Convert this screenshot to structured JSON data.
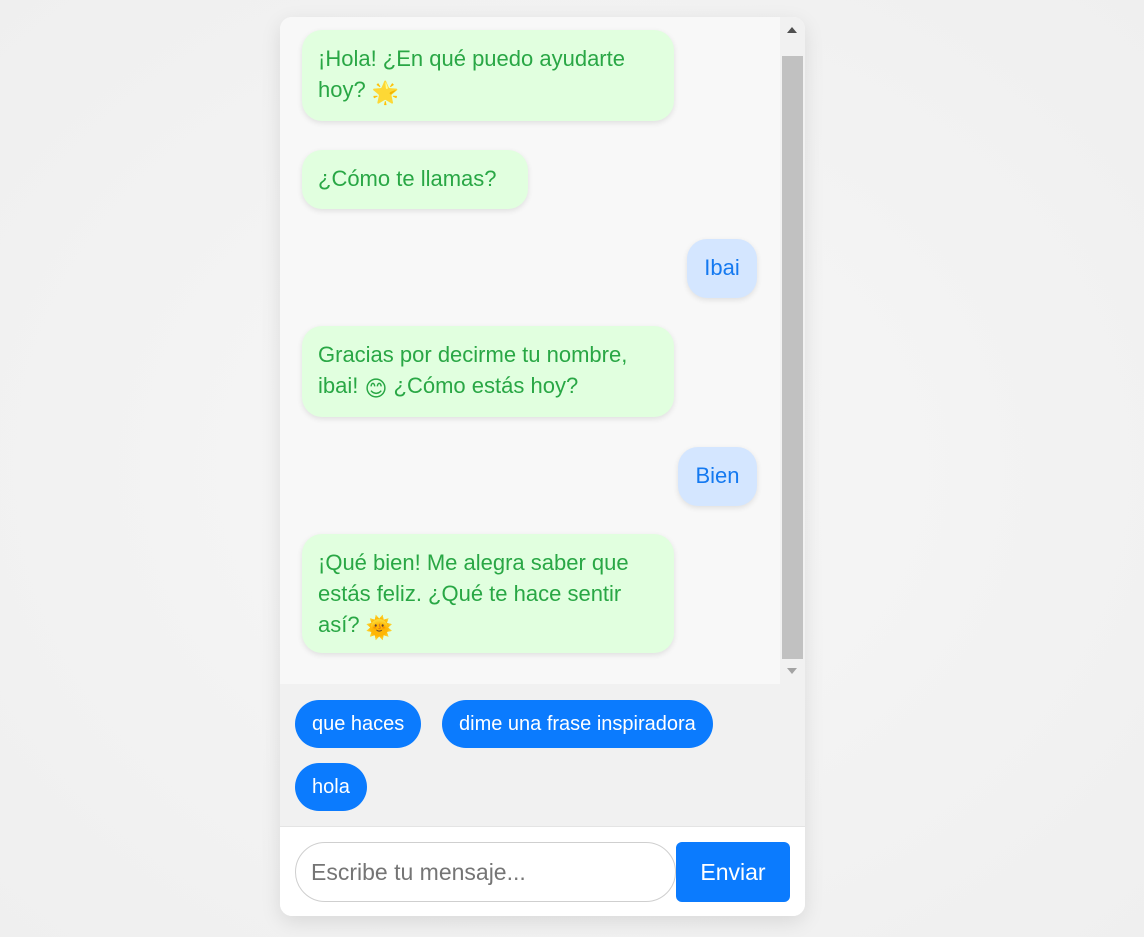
{
  "chat": {
    "messages": [
      {
        "sender": "bot",
        "text": "¡Hola! ¿En qué puedo ayudarte hoy?",
        "emoji": "🌟"
      },
      {
        "sender": "bot",
        "text": "¿Cómo te llamas?",
        "emoji": ""
      },
      {
        "sender": "user",
        "text": "Ibai",
        "emoji": ""
      },
      {
        "sender": "bot",
        "text_before": "Gracias por decirme tu nombre, ibai!",
        "emoji": "😊",
        "text_after": "¿Cómo estás hoy?"
      },
      {
        "sender": "user",
        "text": "Bien",
        "emoji": ""
      },
      {
        "sender": "bot",
        "text": "¡Qué bien! Me alegra saber que estás feliz. ¿Qué te hace sentir así?",
        "emoji": "🌞"
      }
    ]
  },
  "suggestions": {
    "items": [
      {
        "label": "que haces"
      },
      {
        "label": "dime una frase inspiradora"
      },
      {
        "label": "hola"
      }
    ]
  },
  "input": {
    "placeholder": "Escribe tu mensaje...",
    "value": ""
  },
  "send_button": {
    "label": "Enviar"
  },
  "colors": {
    "bot_bubble": "#e1ffdf",
    "bot_text": "#29a745",
    "user_bubble": "#d4e6ff",
    "user_text": "#1479f0",
    "accent": "#0b7bfe"
  }
}
